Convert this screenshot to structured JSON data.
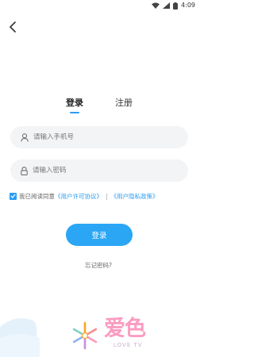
{
  "status_bar": {
    "time": "4:09"
  },
  "tabs": {
    "login": "登录",
    "register": "注册"
  },
  "form": {
    "phone_placeholder": "请输入手机号",
    "password_placeholder": "请输入密码"
  },
  "agreement": {
    "checked": true,
    "prefix": "我已阅读同意",
    "user_agreement": "《用户许可协议》",
    "separator": "|",
    "privacy_policy": "《用户隐私政策》"
  },
  "login_button": "登录",
  "forgot_password": "忘记密码?",
  "logo": {
    "text": "爱色",
    "subtext": "LOVE TV"
  },
  "colors": {
    "accent": "#2aa6f5",
    "logo": "#fb9bc0"
  }
}
